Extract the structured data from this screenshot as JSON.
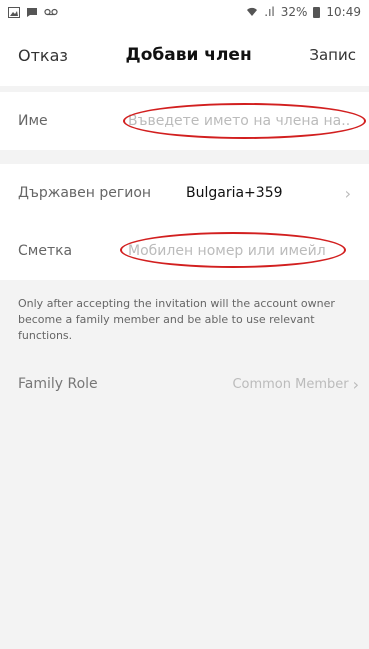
{
  "status_bar": {
    "icons_left": [
      "image-icon",
      "chat-icon",
      "voicemail-icon"
    ],
    "signal": ".ıl",
    "battery_percent": "32%",
    "time": "10:49"
  },
  "header": {
    "cancel_label": "Отказ",
    "title": "Добави член",
    "save_label": "Запис"
  },
  "form": {
    "name": {
      "label": "Име",
      "placeholder": "Въведете името на члена на..."
    },
    "region": {
      "label": "Държавен регион",
      "value": "Bulgaria+359"
    },
    "account": {
      "label": "Сметка",
      "placeholder": "Мобилен номер или имейл"
    }
  },
  "note": "Only after accepting the invitation will the account owner become a family member and be able to use relevant functions.",
  "family_role": {
    "label": "Family Role",
    "value": "Common Member"
  },
  "colors": {
    "annotation": "#d21f1f",
    "background": "#f3f3f3"
  }
}
